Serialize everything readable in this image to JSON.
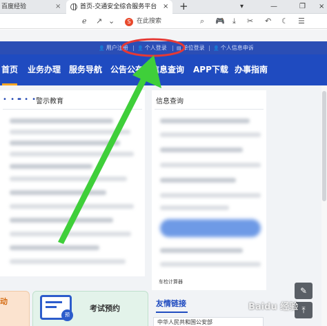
{
  "browser": {
    "prev_tab": {
      "title": "百度经验"
    },
    "active_tab": {
      "title": "首页-交通安全综合服务平台"
    },
    "new_tab_icon": "plus-icon",
    "search_box": {
      "text": "在此搜索"
    }
  },
  "site": {
    "top_links": [
      {
        "label": "用户注册"
      },
      {
        "label": "个人登录"
      },
      {
        "label": "单位登录"
      },
      {
        "label": "个人信息申诉"
      }
    ],
    "nav": [
      {
        "label": "首页"
      },
      {
        "label": "业务办理"
      },
      {
        "label": "服务导航"
      },
      {
        "label": "公告公布"
      },
      {
        "label": "信息查询"
      },
      {
        "label": "APP下载"
      },
      {
        "label": "办事指南"
      }
    ],
    "active_nav_index": 0,
    "sections": {
      "left_title": "警示教育",
      "right_title": "信息查询",
      "calculator_label": "车检计算器",
      "friend_links_title": "友情链接",
      "friend_link_item": "中华人民共和国公安部"
    },
    "cards": {
      "orange_card_text": "动",
      "green_card_text": "考试预约",
      "green_card_badge": "预"
    }
  },
  "annotation": {
    "highlight_color": "#e53935",
    "arrow_color": "#3fcf3a",
    "highlighted_item": "个人登录"
  },
  "watermark": {
    "text": "Baidu 经验"
  },
  "colors": {
    "nav_bg": "#1f4bc0",
    "top_bar_bg": "#2b4eb5",
    "nav_active_underline": "#f5a623"
  }
}
